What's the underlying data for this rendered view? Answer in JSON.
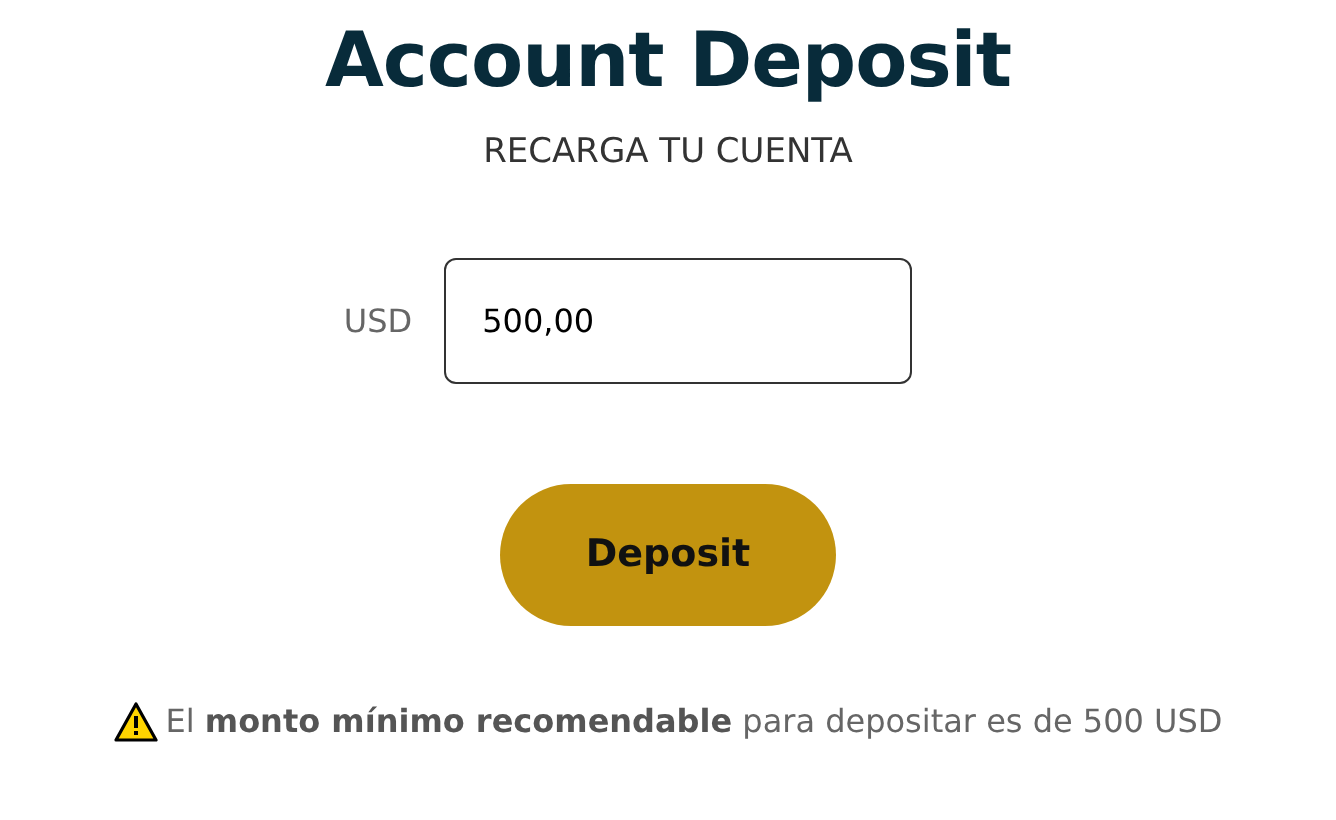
{
  "title": "Account Deposit",
  "subtitle": "RECARGA TU CUENTA",
  "amount": {
    "label": "USD",
    "value": "500,00"
  },
  "button": "Deposit",
  "notice": "El **monto mínimo recomendable** para depositar es de 500 USD"
}
